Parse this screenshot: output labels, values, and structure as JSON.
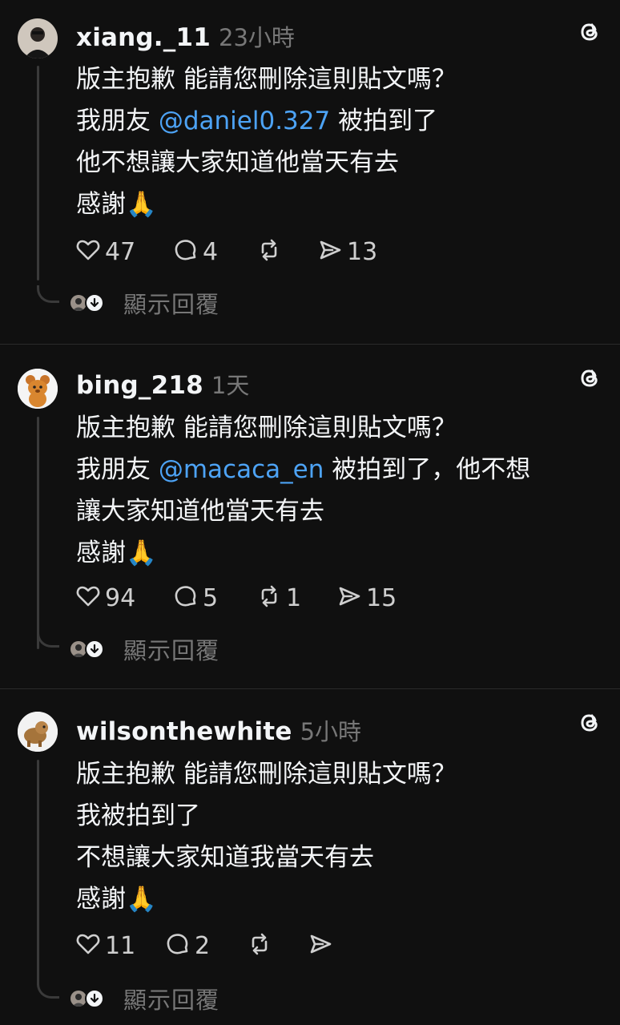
{
  "posts": [
    {
      "username": "xiang._11",
      "time": "23小時",
      "lines": [
        {
          "text": "版主抱歉 能請您刪除這則貼文嗎？"
        },
        {
          "before": "我朋友 ",
          "mention": "@daniel0.327",
          "after": " 被拍到了"
        },
        {
          "text": "他不想讓大家知道他當天有去"
        },
        {
          "text": "感謝🙏"
        }
      ],
      "likes": "47",
      "comments": "4",
      "reposts": "",
      "shares": "13",
      "show_replies": "顯示回覆"
    },
    {
      "username": "bing_218",
      "time": "1天",
      "lines": [
        {
          "text": "版主抱歉 能請您刪除這則貼文嗎？"
        },
        {
          "before": "我朋友 ",
          "mention": "@macaca_en",
          "after": " 被拍到了，他不想"
        },
        {
          "text": "讓大家知道他當天有去"
        },
        {
          "text": "感謝🙏"
        }
      ],
      "likes": "94",
      "comments": "5",
      "reposts": "1",
      "shares": "15",
      "show_replies": "顯示回覆"
    },
    {
      "username": "wilsonthewhite",
      "time": "5小時",
      "lines": [
        {
          "text": "版主抱歉 能請您刪除這則貼文嗎？"
        },
        {
          "text": "我被拍到了"
        },
        {
          "text": "不想讓大家知道我當天有去"
        },
        {
          "text": "感謝🙏"
        }
      ],
      "likes": "11",
      "comments": "2",
      "reposts": "",
      "shares": "",
      "show_replies": "顯示回覆"
    }
  ],
  "icons": {
    "like": "heart-icon",
    "comment": "comment-bubble-icon",
    "repost": "repost-icon",
    "share": "share-send-icon",
    "app": "threads-logo-icon"
  },
  "colors": {
    "background": "#101010",
    "text": "#f3f5f7",
    "muted": "#777777",
    "mention": "#4da3f5"
  }
}
